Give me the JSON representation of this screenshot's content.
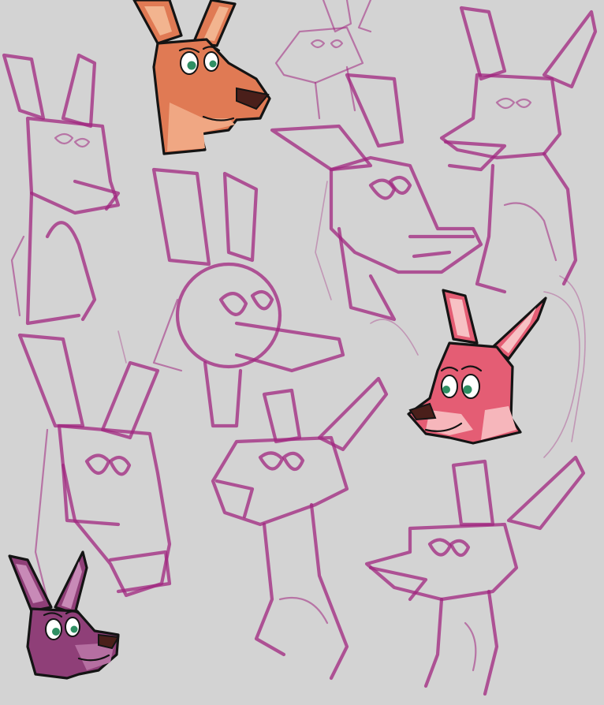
{
  "colors": {
    "background": "#d3d3d3",
    "sketch": "#a0267f",
    "orange_head_base": "#e07a54",
    "orange_head_light": "#f0a783",
    "orange_head_inner_ear": "#f2b48f",
    "pink_head_base": "#e45d74",
    "pink_head_light": "#f6b6bb",
    "pink_head_inner_ear": "#f7c1c4",
    "purple_head_base": "#8f3f78",
    "purple_head_light": "#b56fa1",
    "purple_head_inner_ear": "#c88ab7",
    "eye_iris": "#2f8f63",
    "eye_white": "#ffffff",
    "nose": "#4a1f1a",
    "ink": "#141414"
  },
  "figures": [
    {
      "kind": "colored-kangaroo-head",
      "palette": "orange",
      "facing": "right"
    },
    {
      "kind": "colored-kangaroo-head",
      "palette": "pink",
      "facing": "left"
    },
    {
      "kind": "colored-kangaroo-head",
      "palette": "purple",
      "facing": "right"
    },
    {
      "kind": "pencil-sketch",
      "subject": "kangaroo-body"
    },
    {
      "kind": "pencil-sketch",
      "subject": "kangaroo-head"
    }
  ]
}
